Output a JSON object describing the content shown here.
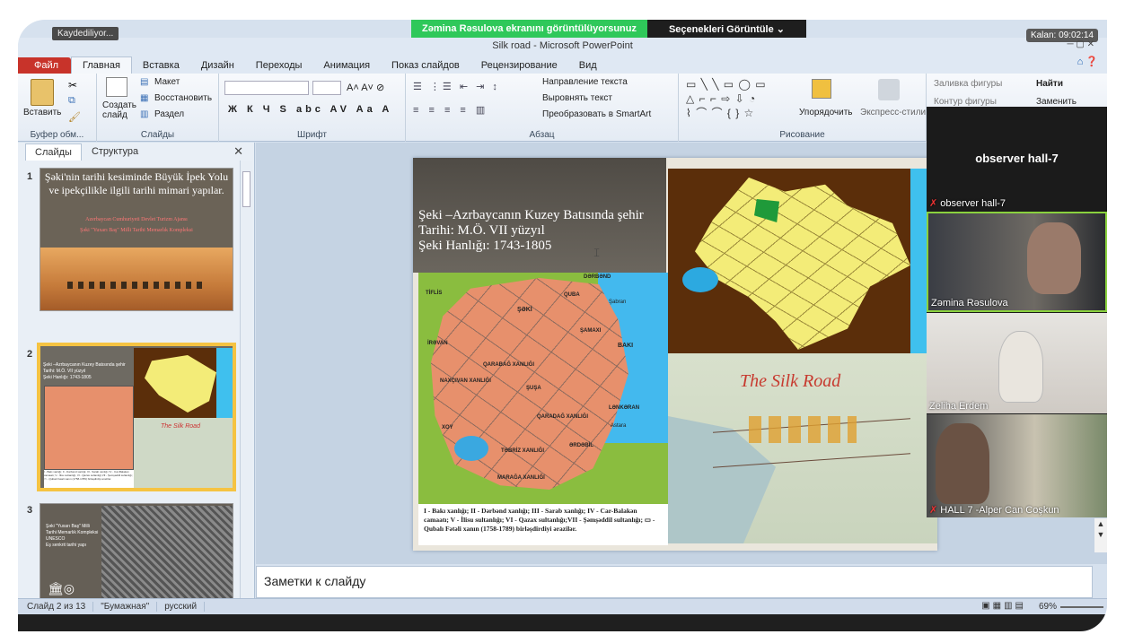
{
  "share": {
    "banner": "Zəmina Rəsulova ekranını görüntülüyorsunuz",
    "options": "Seçenekleri Görüntüle ⌄"
  },
  "window": {
    "title": "Silk road - Microsoft PowerPoint",
    "saving_tooltip": "Kaydediliyor...",
    "timer": "Kalan: 09:02:14"
  },
  "ribbon_tabs": [
    "Файл",
    "Главная",
    "Вставка",
    "Дизайн",
    "Переходы",
    "Анимация",
    "Показ слайдов",
    "Рецензирование",
    "Вид"
  ],
  "ribbon": {
    "paste": "Вставить",
    "clipboard_group": "Буфер обм...",
    "new_slide": "Создать слайд",
    "layout": "Макет",
    "reset": "Восстановить",
    "section": "Раздел",
    "slides_group": "Слайды",
    "font_group": "Шрифт",
    "paragraph_group": "Абзац",
    "text_direction": "Направление текста",
    "align_text": "Выровнять текст",
    "smartart": "Преобразовать в SmartArt",
    "arrange": "Упорядочить",
    "quick_styles": "Экспресс-стили",
    "shape_fill": "Заливка фигуры",
    "shape_outline": "Контур фигуры",
    "drawing_group": "Рисование",
    "find": "Найти",
    "replace": "Заменить"
  },
  "panel": {
    "tab_slides": "Слайды",
    "tab_outline": "Структура",
    "slide1_title": "Şəki'nin tarihi kesiminde Büyük İpek Yolu ve ipekçilikle ilgili tarihi mimari yapılar.",
    "slide1_sub": "Azerbaycan Cumhuriyeti Devlet Turizm Ajansı",
    "slide1_sub2": "Şəki \"Yuxarı Baş\" Milli Tarihi Memarlık Kompleksi",
    "slide2_lines": [
      "Şeki –Azrbaycanın Kuzey Batısında şehir",
      "Tarihi: M.Ö. VII yüzyıl",
      "Şeki Hanlığı: 1743-1805"
    ],
    "slide3_text": [
      "Şəki \"Yuxarı Baş\" Milli Tarihi Memarlık Kompleksi",
      "UNESCO",
      "Eş senkrit tarihi yapı"
    ]
  },
  "slide": {
    "line1": "Şeki –Azrbaycanın Kuzey Batısında şehir",
    "line2": "Tarihi: M.Ö. VII yüzyıl",
    "line3": "Şeki Hanlığı: 1743-1805",
    "silk_road_title": "The Silk Road",
    "map_labels": [
      "TİFLİS",
      "DƏRBƏND",
      "QUBA",
      "Şabran",
      "ŞƏKİ",
      "ŞAMAXI",
      "BAKI",
      "QARABAĞ XANLIĞI",
      "ŞUŞA",
      "LƏNKƏRAN",
      "Astara",
      "TƏBRİZ XANLIĞI",
      "MARAĞA XANLIĞI",
      "NAXÇIVAN XANLIĞI",
      "İRƏVAN",
      "QARADAĞ XANLIĞI",
      "XOY",
      "ƏRDƏBİL"
    ],
    "caption": "I - Bakı xanlığı; II - Dərbənd xanlığı; III - Sarab xanlığı; IV - Car-Balakən camaatı; V - İlisu sultanlığı; VI - Qazax sultanlığı;VII - Şəmşəddil sultanlığı; ▭ - Qubalı Fətəli xanın (1758-1789) birləşdirdiyi ərazilər."
  },
  "notes_placeholder": "Заметки к слайду",
  "status": {
    "slide_of": "Слайд 2 из 13",
    "theme": "\"Бумажная\"",
    "lang": "русский",
    "zoom": "69%"
  },
  "video": {
    "observer_name": "observer hall-7",
    "observer_label": "observer hall-7",
    "p1": "Zəmina Rəsulova",
    "p2": "Zeliha Erdem",
    "p3": "HALL 7 -Alper Can Coşkun"
  }
}
